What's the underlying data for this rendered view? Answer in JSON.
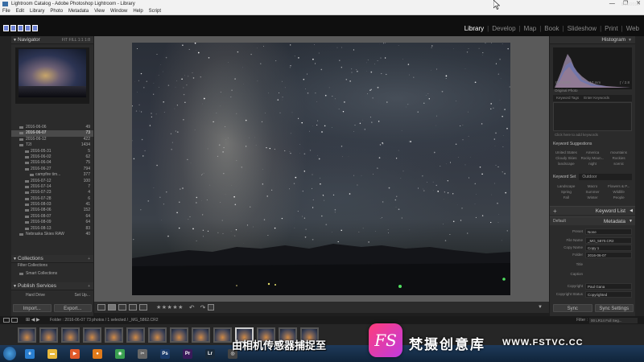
{
  "window": {
    "title": "Lightroom Catalog - Adobe Photoshop Lightroom - Library",
    "controls": [
      "—",
      "❐",
      "✕"
    ]
  },
  "menu": [
    "File",
    "Edit",
    "Library",
    "Photo",
    "Metadata",
    "View",
    "Window",
    "Help",
    "Script"
  ],
  "modules": {
    "items": [
      "Library",
      "Develop",
      "Map",
      "Book",
      "Slideshow",
      "Print",
      "Web"
    ],
    "active": "Library"
  },
  "left_panel": {
    "navigator": {
      "title": "Navigator",
      "zoom_options": "FIT  FILL  1:1  1:8"
    },
    "folders": [
      {
        "name": "2016-06-06",
        "count": "49",
        "level": 0
      },
      {
        "name": "2016-06-07",
        "count": "73",
        "level": 0,
        "selected": true
      },
      {
        "name": "2016-06-12",
        "count": "422",
        "level": 0
      },
      {
        "name": "T2I",
        "count": "1434",
        "level": 0
      },
      {
        "name": "2016-05-31",
        "count": "5",
        "level": 1
      },
      {
        "name": "2016-06-02",
        "count": "62",
        "level": 1
      },
      {
        "name": "2016-06-04",
        "count": "75",
        "level": 1
      },
      {
        "name": "2016-06-27",
        "count": "794",
        "level": 1
      },
      {
        "name": "campfire tim...",
        "count": "377",
        "level": 2
      },
      {
        "name": "2016-07-12",
        "count": "100",
        "level": 1
      },
      {
        "name": "2016-07-14",
        "count": "7",
        "level": 1
      },
      {
        "name": "2016-07-23",
        "count": "4",
        "level": 1
      },
      {
        "name": "2016-07-28",
        "count": "6",
        "level": 1
      },
      {
        "name": "2016-08-03",
        "count": "41",
        "level": 1
      },
      {
        "name": "2016-08-06",
        "count": "152",
        "level": 1
      },
      {
        "name": "2016-08-07",
        "count": "64",
        "level": 1
      },
      {
        "name": "2016-08-09",
        "count": "64",
        "level": 1
      },
      {
        "name": "2016-08-13",
        "count": "83",
        "level": 1
      },
      {
        "name": "Nebraska Skies RAW",
        "count": "40",
        "level": 0
      }
    ],
    "collections": {
      "title": "Collections",
      "filter": "Filter Collections",
      "smart": "Smart Collections"
    },
    "publish": {
      "title": "Publish Services",
      "hard_drive": "Hard Drive",
      "setup": "Set Up..."
    },
    "import_label": "Import...",
    "export_label": "Export..."
  },
  "toolbar": {
    "rating": "★★★★★"
  },
  "right_panel": {
    "histogram": {
      "title": "Histogram",
      "iso": "ISO 6400",
      "focal": "17 mm",
      "aperture": "ƒ / 2.8",
      "original": "Original Photo"
    },
    "keyword_tabs": [
      "Keyword Tags",
      "Enter Keywords"
    ],
    "click_hint": "Click here to add keywords",
    "suggestions": {
      "title": "Keyword Suggestions",
      "items": [
        "United States",
        "America",
        "mountains",
        "Cloudy Skies",
        "Rocky Moun...",
        "Rockies",
        "landscape",
        "night",
        "scenic"
      ]
    },
    "keyword_set": {
      "label": "Keyword Set",
      "value": "Outdoor",
      "items": [
        "Landscape",
        "Macro",
        "Flowers & P...",
        "Spring",
        "Summer",
        "Wildlife",
        "Fall",
        "Winter",
        "People"
      ]
    },
    "keyword_list": "Keyword List",
    "metadata": {
      "title": "Metadata",
      "default": "Default",
      "rows": [
        {
          "k": "Preset",
          "v": "None"
        },
        {
          "k": "File Name",
          "v": "_MG_5870.CR2"
        },
        {
          "k": "Copy Name",
          "v": "Copy 1"
        },
        {
          "k": "Folder",
          "v": "2016-06-07"
        },
        {
          "k": "Title",
          "v": ""
        },
        {
          "k": "Caption",
          "v": ""
        },
        {
          "k": "Copyright",
          "v": "Paul Gana"
        },
        {
          "k": "Copyright Status",
          "v": "Copyrighted"
        }
      ]
    },
    "sync_label": "Sync",
    "sync_settings_label": "Sync Settings"
  },
  "filmstrip_bar": {
    "source": "Folder : 2016-06-07     73 photos / 1 selected / _MG_5862.CR2",
    "filter_label": "Filter :",
    "filter_value": "00 LR14 Full Seg..."
  },
  "taskbar": {
    "apps": [
      {
        "name": "ie",
        "label": "e",
        "color": "#2a7fd0"
      },
      {
        "name": "explorer",
        "label": "▬",
        "color": "#e8b83a"
      },
      {
        "name": "media",
        "label": "▶",
        "color": "#e05a2a"
      },
      {
        "name": "firefox",
        "label": "●",
        "color": "#e07a1a"
      },
      {
        "name": "chrome",
        "label": "◉",
        "color": "#3aa050"
      },
      {
        "name": "tool",
        "label": "✂",
        "color": "#666"
      },
      {
        "name": "photoshop",
        "label": "Ps",
        "color": "#1a3a6a"
      },
      {
        "name": "premiere",
        "label": "Pr",
        "color": "#3a1a5a"
      },
      {
        "name": "lightroom",
        "label": "Lr",
        "color": "#1a2a3a"
      },
      {
        "name": "capture",
        "label": "◎",
        "color": "#444"
      }
    ],
    "date": "8/30/2016"
  },
  "overlay": {
    "subtitle": "由相机传感器捕捉至",
    "brand_badge": "FS",
    "brand_name": "梵摄创意库",
    "brand_url": "WWW.FSTVC.CC"
  }
}
